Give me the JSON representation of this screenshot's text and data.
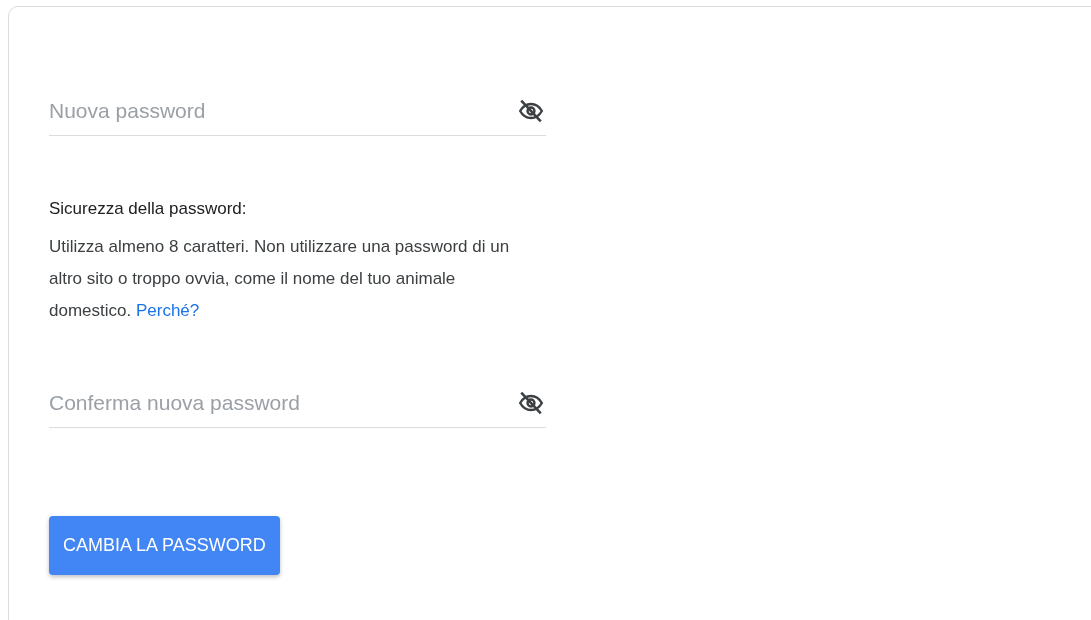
{
  "fields": [
    {
      "placeholder": "Nuova password",
      "password_visible": false
    },
    {
      "placeholder": "Conferma nuova password",
      "password_visible": false
    }
  ],
  "strength": {
    "title": "Sicurezza della password:",
    "text": "Utilizza almeno 8 caratteri. Non utilizzare una password di un altro sito o troppo ovvia, come il nome del tuo animale domestico.",
    "link": "Perché?"
  },
  "button": "CAMBIA LA PASSWORD"
}
